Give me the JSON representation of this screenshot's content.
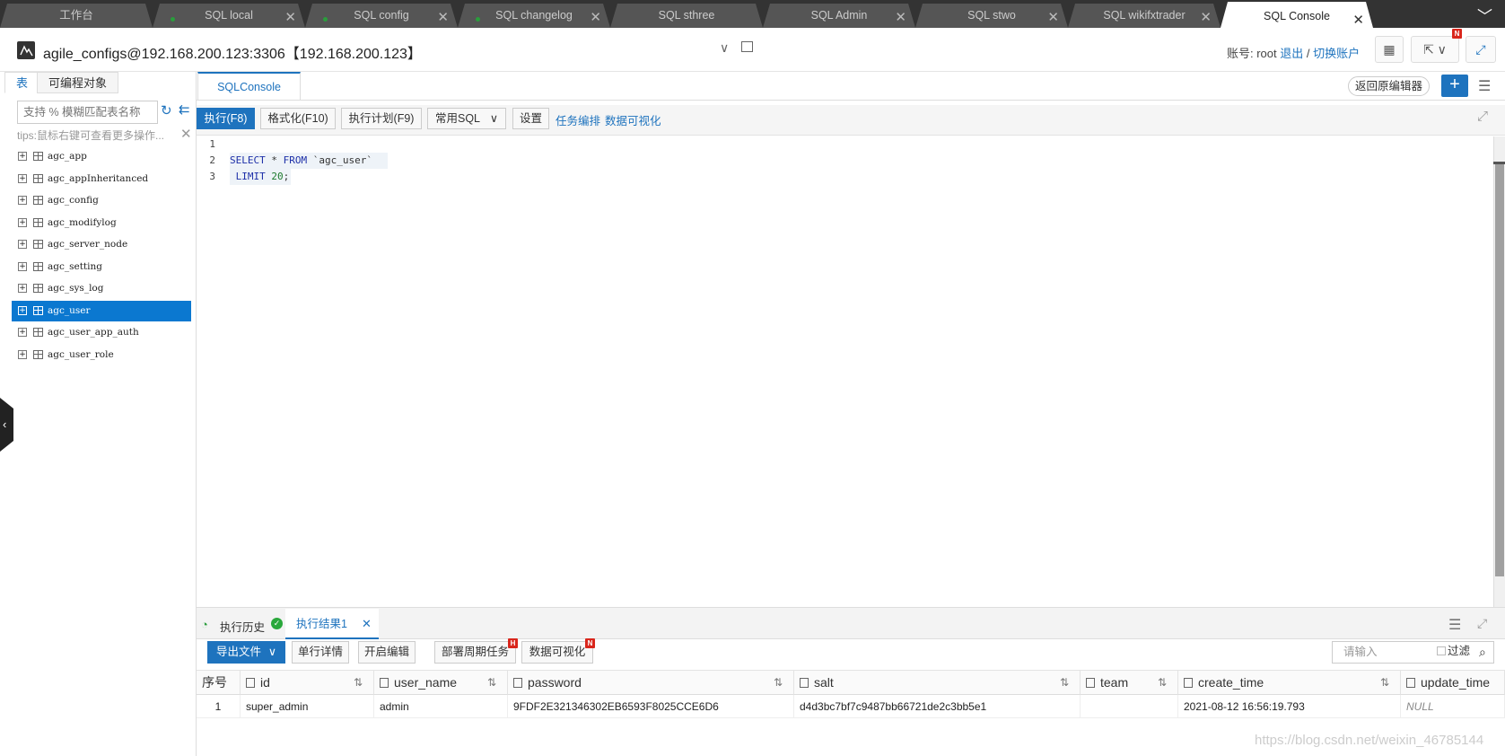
{
  "tabs": [
    {
      "label": "工作台",
      "dot": false,
      "close": false,
      "active": false
    },
    {
      "label": "SQL local",
      "dot": true,
      "close": true,
      "active": false
    },
    {
      "label": "SQL config",
      "dot": true,
      "close": true,
      "active": false
    },
    {
      "label": "SQL changelog",
      "dot": true,
      "close": true,
      "active": false
    },
    {
      "label": "SQL sthree",
      "dot": false,
      "close": false,
      "active": false
    },
    {
      "label": "SQL Admin",
      "dot": false,
      "close": true,
      "active": false
    },
    {
      "label": "SQL stwo",
      "dot": false,
      "close": true,
      "active": false
    },
    {
      "label": "SQL wikifxtrader",
      "dot": false,
      "close": true,
      "active": false
    },
    {
      "label": "SQL Console",
      "dot": false,
      "close": true,
      "active": true
    }
  ],
  "header": {
    "connection": "agile_configs@192.168.200.123:3306【192.168.200.123】",
    "account_label": "账号: root",
    "logout": "退出",
    "separator": " / ",
    "switch_account": "切换账户",
    "badge_n": "N"
  },
  "left": {
    "tab_tables": "表",
    "tab_programmable": "可编程对象",
    "search_placeholder": "支持 % 模糊匹配表名称",
    "tips": "tips:鼠标右键可查看更多操作...",
    "tables": [
      {
        "name": "agc_app",
        "selected": false
      },
      {
        "name": "agc_appInheritanced",
        "selected": false
      },
      {
        "name": "agc_config",
        "selected": false
      },
      {
        "name": "agc_modifylog",
        "selected": false
      },
      {
        "name": "agc_server_node",
        "selected": false
      },
      {
        "name": "agc_setting",
        "selected": false
      },
      {
        "name": "agc_sys_log",
        "selected": false
      },
      {
        "name": "agc_user",
        "selected": true
      },
      {
        "name": "agc_user_app_auth",
        "selected": false
      },
      {
        "name": "agc_user_role",
        "selected": false
      }
    ]
  },
  "console": {
    "tab": "SQLConsole",
    "return_button": "返回原编辑器",
    "toolbar": {
      "run": "执行(F8)",
      "format": "格式化(F10)",
      "plan": "执行计划(F9)",
      "common_sql": "常用SQL",
      "settings": "设置",
      "task_orchestration": "任务编排",
      "data_visualization": "数据可视化"
    },
    "editor": {
      "line_numbers": [
        "1",
        "2",
        "3"
      ],
      "line2": {
        "kw1": "SELECT",
        "star": " * ",
        "kw2": "FROM",
        "tbl": " `agc_user`"
      },
      "line3": {
        "kw": " LIMIT",
        "num": "20",
        "end": ";"
      }
    }
  },
  "results": {
    "history_tab": "执行历史",
    "result_tab": "执行结果1",
    "export": "导出文件",
    "row_detail": "单行详情",
    "enable_edit": "开启编辑",
    "deploy_task": "部署周期任务",
    "deploy_badge": "H",
    "visualize": "数据可视化",
    "visualize_badge": "N",
    "search_placeholder": "请输入",
    "filter_label": "过滤",
    "columns": [
      "序号",
      "id",
      "user_name",
      "password",
      "salt",
      "team",
      "create_time",
      "update_time"
    ],
    "rows": [
      [
        "1",
        "super_admin",
        "admin",
        "9FDF2E321346302EB6593F8025CCE6D6",
        "d4d3bc7bf7c9487bb66721de2c3bb5e1",
        "",
        "2021-08-12 16:56:19.793",
        "NULL"
      ]
    ]
  },
  "watermark": "https://blog.csdn.net/weixin_46785144"
}
